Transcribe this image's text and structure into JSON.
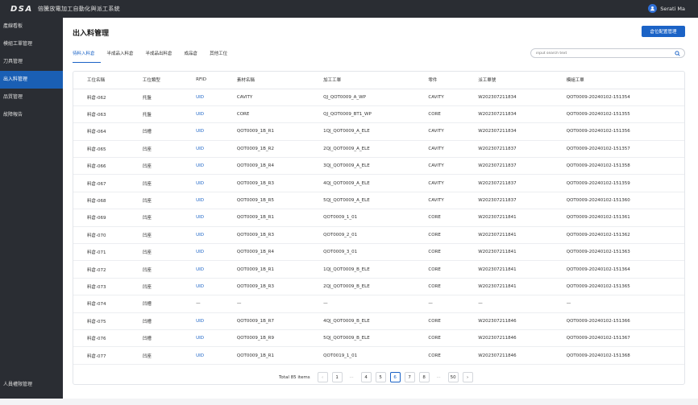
{
  "app": {
    "logo": "DSA",
    "title": "倍騰放電加工自動化與派工系統",
    "user": "Serati Ma",
    "accent": "#1b63c6",
    "sidebar_bg": "#2a2d33"
  },
  "sidebar": {
    "items": [
      {
        "label": "產線看板",
        "active": false
      },
      {
        "label": "模組工單管理",
        "active": false
      },
      {
        "label": "刀具管理",
        "active": false
      },
      {
        "label": "出入料管理",
        "active": true
      },
      {
        "label": "品質管理",
        "active": false
      },
      {
        "label": "故障報告",
        "active": false
      }
    ],
    "bottom_item": "人員權限管理"
  },
  "page": {
    "title": "出入料管理",
    "action_button": "倉位配置管理",
    "tabs": [
      {
        "label": "待料入料倉",
        "active": true
      },
      {
        "label": "半成品入料倉",
        "active": false
      },
      {
        "label": "半成品出料倉",
        "active": false
      },
      {
        "label": "成品倉",
        "active": false
      },
      {
        "label": "其他工位",
        "active": false
      }
    ],
    "search_placeholder": "input search text"
  },
  "table": {
    "columns": [
      "工位名稱",
      "工位類型",
      "RFID",
      "素材名稱",
      "加工工單",
      "零件",
      "派工單號",
      "模組工單"
    ],
    "rows": [
      [
        "料倉-062",
        "托盤",
        "UID",
        "CAVITY",
        "QJ_QOT0009_A_WP",
        "CAVITY",
        "W202307211834",
        "QOT0009-20240102-151354"
      ],
      [
        "料倉-063",
        "托盤",
        "UID",
        "CORE",
        "QJ_QOT0009_BT1_WP",
        "CORE",
        "W202307211834",
        "QOT0009-20240102-151355"
      ],
      [
        "料倉-064",
        "凹槽",
        "UID",
        "QOT0009_1B_R1",
        "1QJ_QOT0009_A_ELE",
        "CAVITY",
        "W202307211834",
        "QOT0009-20240102-151356"
      ],
      [
        "料倉-065",
        "凹座",
        "UID",
        "QOT0009_1B_R2",
        "2QJ_QOT0009_A_ELE",
        "CAVITY",
        "W202307211837",
        "QOT0009-20240102-151357"
      ],
      [
        "料倉-066",
        "凹座",
        "UID",
        "QOT0009_1B_R4",
        "3QJ_QOT0009_A_ELE",
        "CAVITY",
        "W202307211837",
        "QOT0009-20240102-151358"
      ],
      [
        "料倉-067",
        "凹座",
        "UID",
        "QOT0009_1B_R3",
        "4QJ_QOT0009_A_ELE",
        "CAVITY",
        "W202307211837",
        "QOT0009-20240102-151359"
      ],
      [
        "料倉-068",
        "凹座",
        "UID",
        "QOT0009_1B_R5",
        "5QJ_QOT0009_A_ELE",
        "CAVITY",
        "W202307211837",
        "QOT0009-20240102-151360"
      ],
      [
        "料倉-069",
        "凹座",
        "UID",
        "QOT0009_1B_R1",
        "QOT0009_1_01",
        "CORE",
        "W202307211841",
        "QOT0009-20240102-151361"
      ],
      [
        "料倉-070",
        "凹座",
        "UID",
        "QOT0009_1B_R3",
        "QOT0009_2_01",
        "CORE",
        "W202307211841",
        "QOT0009-20240102-151362"
      ],
      [
        "料倉-071",
        "凹座",
        "UID",
        "QOT0009_1B_R4",
        "QOT0009_3_01",
        "CORE",
        "W202307211841",
        "QOT0009-20240102-151363"
      ],
      [
        "料倉-072",
        "凹座",
        "UID",
        "QOT0009_1B_R1",
        "1QJ_QOT0009_B_ELE",
        "CORE",
        "W202307211841",
        "QOT0009-20240102-151364"
      ],
      [
        "料倉-073",
        "凹座",
        "UID",
        "QOT0009_1B_R3",
        "2QJ_QOT0009_B_ELE",
        "CORE",
        "W202307211841",
        "QOT0009-20240102-151365"
      ],
      [
        "料倉-074",
        "凹槽",
        "—",
        "—",
        "—",
        "—",
        "—",
        "—"
      ],
      [
        "料倉-075",
        "凹槽",
        "UID",
        "QOT0009_1B_R7",
        "4QJ_QOT0009_B_ELE",
        "CORE",
        "W202307211846",
        "QOT0009-20240102-151366"
      ],
      [
        "料倉-076",
        "凹槽",
        "UID",
        "QOT0009_1B_R9",
        "5QJ_QOT0009_B_ELE",
        "CORE",
        "W202307211846",
        "QOT0009-20240102-151367"
      ],
      [
        "料倉-077",
        "凹座",
        "UID",
        "QOT0009_1B_R1",
        "QOT0019_1_01",
        "CORE",
        "W202307211846",
        "QOT0009-20240102-151368"
      ]
    ]
  },
  "pagination": {
    "total_text": "Total 85 items",
    "pages": [
      "1",
      "4",
      "5",
      "6",
      "7",
      "8",
      "50"
    ],
    "current": "6",
    "ellipsis": "···"
  }
}
